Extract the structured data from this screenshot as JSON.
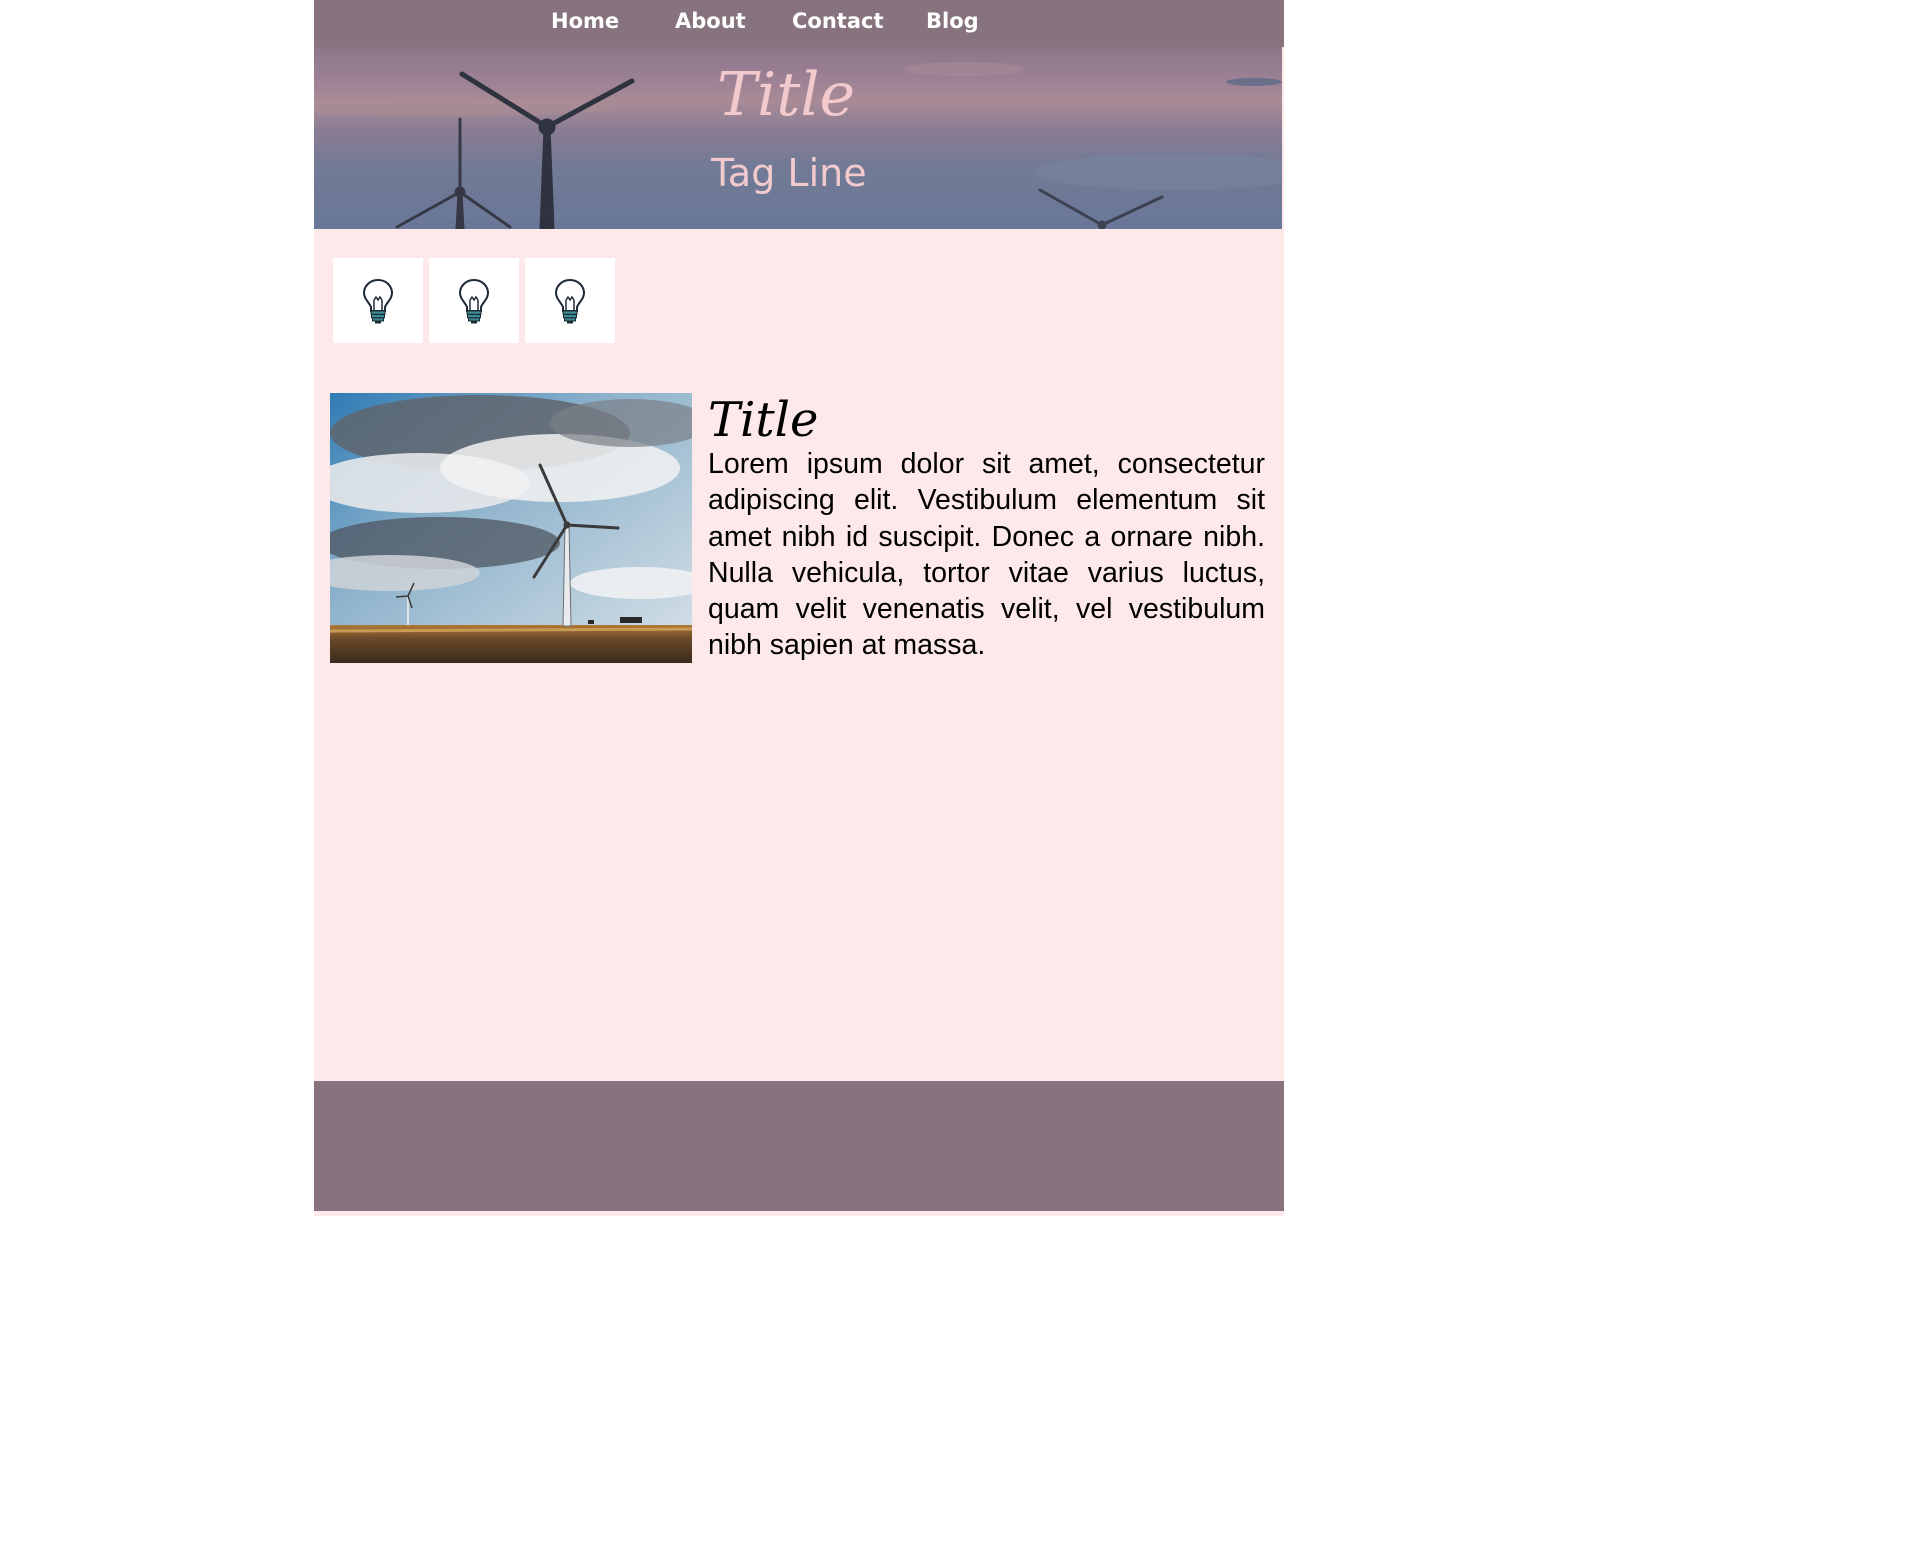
{
  "nav": {
    "items": [
      {
        "label": "Home"
      },
      {
        "label": "About"
      },
      {
        "label": "Contact"
      },
      {
        "label": "Blog"
      }
    ]
  },
  "hero": {
    "title": "Title",
    "tagline": "Tag Line"
  },
  "tiles": [
    {
      "icon": "lightbulb-icon"
    },
    {
      "icon": "lightbulb-icon"
    },
    {
      "icon": "lightbulb-icon"
    }
  ],
  "article": {
    "image": "wind-turbine-field-photo",
    "title": "Title",
    "body": "Lorem ipsum dolor sit amet, consectetur adipiscing elit. Vestibulum elementum sit amet nibh id suscipit. Donec a ornare nibh. Nulla vehicula, tortor vitae varius luctus, quam velit venenatis velit, vel ves­tibulum nibh sapien at massa."
  },
  "colors": {
    "nav_bg": "#86737d",
    "page_bg": "#fde9ea",
    "hero_text": "#f2c9cc",
    "footer_bg": "#86737d"
  }
}
